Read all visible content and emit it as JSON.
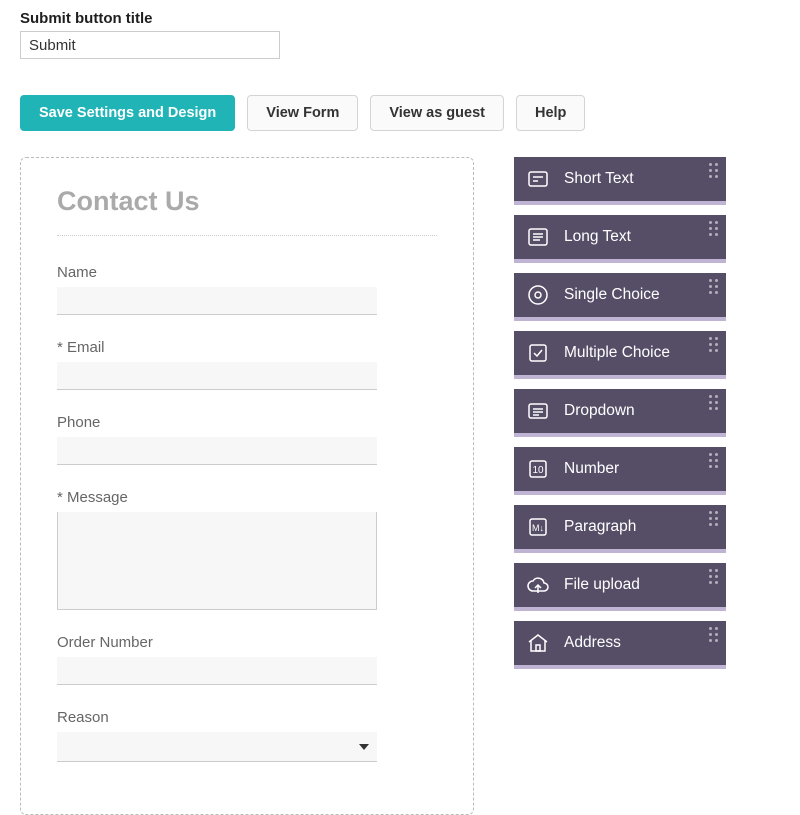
{
  "top_field": {
    "label": "Submit button title",
    "value": "Submit"
  },
  "toolbar": {
    "save": "Save Settings and Design",
    "view_form": "View Form",
    "view_guest": "View as guest",
    "help": "Help"
  },
  "form": {
    "title": "Contact Us",
    "fields": {
      "name": "Name",
      "email": "* Email",
      "phone": "Phone",
      "message": "* Message",
      "order_number": "Order Number",
      "reason": "Reason"
    }
  },
  "palette": {
    "short_text": "Short Text",
    "long_text": "Long Text",
    "single_choice": "Single Choice",
    "multiple_choice": "Multiple Choice",
    "dropdown": "Dropdown",
    "number": "Number",
    "paragraph": "Paragraph",
    "file_upload": "File upload",
    "address": "Address"
  }
}
